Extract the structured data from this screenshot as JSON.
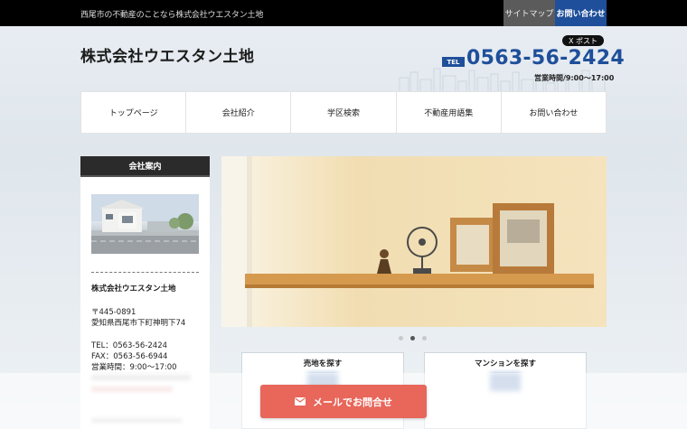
{
  "topbar": {
    "tagline": "西尾市の不動産のことなら株式会社ウエスタン土地",
    "sitemap": "サイトマップ",
    "contact": "お問い合わせ"
  },
  "header": {
    "logo": "株式会社ウエスタン土地",
    "x_post": "X ポスト",
    "tel_label": "TEL",
    "tel_number": "0563-56-2424",
    "hours": "営業時間/9:00〜17:00"
  },
  "nav": {
    "items": [
      {
        "label": "トップページ"
      },
      {
        "label": "会社紹介"
      },
      {
        "label": "学区検索"
      },
      {
        "label": "不動産用語集"
      },
      {
        "label": "お問い合わせ"
      }
    ]
  },
  "sidebar": {
    "heading": "会社案内",
    "company": "株式会社ウエスタン土地",
    "zip": "〒445-0891",
    "address": "愛知県西尾市下町神明下74",
    "tel": "TEL：0563-56-2424",
    "fax": "FAX：0563-56-6944",
    "hours": "営業時間：9:00〜17:00"
  },
  "slider": {
    "dots": 3,
    "active_index": 1
  },
  "search": {
    "land_label": "売地を探す",
    "mansion_label": "マンションを探す"
  },
  "cta": {
    "mail_label": "メールでお問合せ"
  },
  "colors": {
    "brand_blue": "#1f4f9a",
    "cta_red": "#e8665a",
    "topbar_black": "#000000"
  }
}
